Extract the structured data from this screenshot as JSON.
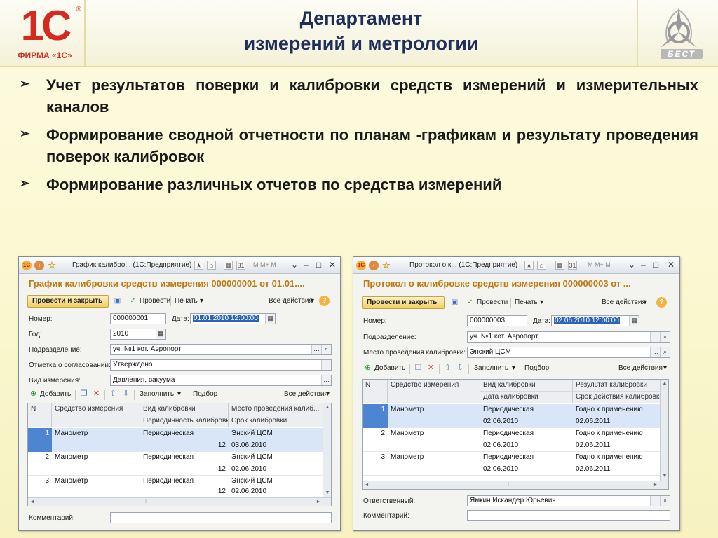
{
  "header": {
    "logo_1c": "1С",
    "logo_firm": "ФИРМА «1С»",
    "title_line1": "Департамент",
    "title_line2": "измерений и метрологии",
    "logo_best": "БЕСТ"
  },
  "bullets": [
    "Учет результатов поверки и калибровки средств измерений и измерительных каналов",
    "Формирование сводной отчетности по планам -графикам и результату проведения поверок калибровок",
    "Формирование различных отчетов по средства измерений"
  ],
  "common": {
    "post_close": "Провести и закрыть",
    "post": "Провести",
    "print": "Печать",
    "all_actions": "Все действия",
    "add": "Добавить",
    "fill": "Заполнить",
    "pick": "Подбор",
    "number_label": "Номер:",
    "date_label": "Дата:",
    "dept_label": "Подразделение:",
    "comment_label": "Комментарий:",
    "tb_mem": "M  M+  M-"
  },
  "window1": {
    "title": "График калибро... (1С:Предприятие)",
    "doc_title": "График калибровки средств измерения 000000001 от 01.01....",
    "number": "000000001",
    "date": "01.01.2010 12:00:00",
    "year_label": "Год:",
    "year": "2010",
    "dept": "уч. №1 кот. Аэропорт",
    "approval_label": "Отметка о согласовании:",
    "approval": "Утверждено",
    "measure_kind_label": "Вид измерения:",
    "measure_kind": "Давления, вакуума",
    "columns": {
      "n": "N",
      "instrument": "Средство измерения",
      "calib_kind": "Вид калибровки",
      "place": "Место проведения калиб...",
      "periodicity": "Периодичность калибровки",
      "term": "Срок калибровки"
    },
    "rows": [
      {
        "n": "1",
        "instrument": "Манометр",
        "calib_kind": "Периодическая",
        "periodicity": "12",
        "place": "Энский ЦСМ",
        "term": "03.06.2010"
      },
      {
        "n": "2",
        "instrument": "Манометр",
        "calib_kind": "Периодическая",
        "periodicity": "12",
        "place": "Энский ЦСМ",
        "term": "02.06.2010"
      },
      {
        "n": "3",
        "instrument": "Манометр",
        "calib_kind": "Периодическая",
        "periodicity": "12",
        "place": "Энский ЦСМ",
        "term": "02.06.2010"
      }
    ],
    "comment": ""
  },
  "window2": {
    "title": "Протокол о к... (1С:Предприятие)",
    "doc_title": "Протокол о калибровке средств измерения 000000003 от ...",
    "number": "000000003",
    "date": "02.06.2010 12:00:00",
    "dept": "уч. №1 кот. Аэропорт",
    "place_label": "Место проведения калибровки:",
    "place": "Энский ЦСМ",
    "columns": {
      "n": "N",
      "instrument": "Средство измерения",
      "calib_kind": "Вид калибровки",
      "result": "Результат калибровки",
      "calib_date": "Дата калибровки",
      "validity": "Срок действия калибровки"
    },
    "rows": [
      {
        "n": "1",
        "instrument": "Манометр",
        "calib_kind": "Периодическая",
        "calib_date": "02.06.2010",
        "result": "Годно к применению",
        "validity": "02.06.2011"
      },
      {
        "n": "2",
        "instrument": "Манометр",
        "calib_kind": "Периодическая",
        "calib_date": "02.06.2010",
        "result": "Годно к применению",
        "validity": "02.06.2011"
      },
      {
        "n": "3",
        "instrument": "Манометр",
        "calib_kind": "Периодическая",
        "calib_date": "02.06.2010",
        "result": "Годно к применению",
        "validity": "02.06.2011"
      }
    ],
    "responsible_label": "Ответственный:",
    "responsible": "Ямкин Искандер Юрьевич",
    "comment": ""
  }
}
